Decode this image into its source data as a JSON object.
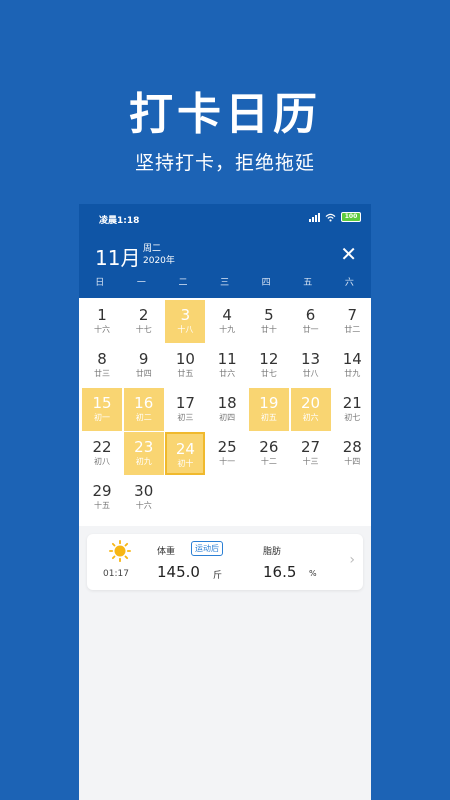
{
  "hero": {
    "title": "打卡日历",
    "subtitle": "坚持打卡，拒绝拖延"
  },
  "status": {
    "time": "凌晨1:18",
    "battery": "100"
  },
  "calendar": {
    "month": "11月",
    "weekday": "周二",
    "year": "2020年",
    "close": "✕",
    "weekdays": [
      "日",
      "一",
      "二",
      "三",
      "四",
      "五",
      "六"
    ],
    "days": [
      {
        "d": "1",
        "l": "十六"
      },
      {
        "d": "2",
        "l": "十七"
      },
      {
        "d": "3",
        "l": "十八",
        "checked": true
      },
      {
        "d": "4",
        "l": "十九"
      },
      {
        "d": "5",
        "l": "廿十"
      },
      {
        "d": "6",
        "l": "廿一"
      },
      {
        "d": "7",
        "l": "廿二"
      },
      {
        "d": "8",
        "l": "廿三"
      },
      {
        "d": "9",
        "l": "廿四"
      },
      {
        "d": "10",
        "l": "廿五"
      },
      {
        "d": "11",
        "l": "廿六"
      },
      {
        "d": "12",
        "l": "廿七"
      },
      {
        "d": "13",
        "l": "廿八"
      },
      {
        "d": "14",
        "l": "廿九"
      },
      {
        "d": "15",
        "l": "初一",
        "checked": true
      },
      {
        "d": "16",
        "l": "初二",
        "checked": true
      },
      {
        "d": "17",
        "l": "初三"
      },
      {
        "d": "18",
        "l": "初四"
      },
      {
        "d": "19",
        "l": "初五",
        "checked": true
      },
      {
        "d": "20",
        "l": "初六",
        "checked": true
      },
      {
        "d": "21",
        "l": "初七"
      },
      {
        "d": "22",
        "l": "初八"
      },
      {
        "d": "23",
        "l": "初九",
        "checked": true
      },
      {
        "d": "24",
        "l": "初十",
        "today": true
      },
      {
        "d": "25",
        "l": "十一"
      },
      {
        "d": "26",
        "l": "十二"
      },
      {
        "d": "27",
        "l": "十三"
      },
      {
        "d": "28",
        "l": "十四"
      },
      {
        "d": "29",
        "l": "十五"
      },
      {
        "d": "30",
        "l": "十六"
      }
    ]
  },
  "record": {
    "time": "01:17",
    "weight_label": "体重",
    "tag": "运动后",
    "weight_value": "145.0",
    "weight_unit": "斤",
    "fat_label": "脂肪",
    "fat_value": "16.5",
    "fat_unit": "%",
    "icon": "sun-icon",
    "sun_color": "#f7b614"
  }
}
